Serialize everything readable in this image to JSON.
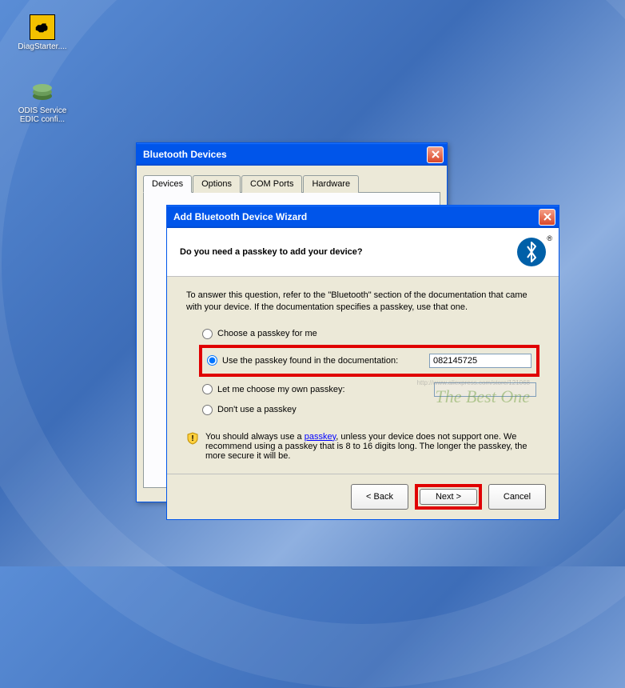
{
  "desktop": {
    "icons": [
      {
        "label": "DiagStarter...."
      },
      {
        "label": "ODIS Service EDIC confi..."
      }
    ]
  },
  "bt_window": {
    "title": "Bluetooth Devices",
    "tabs": [
      "Devices",
      "Options",
      "COM Ports",
      "Hardware"
    ]
  },
  "wizard": {
    "title": "Add Bluetooth Device Wizard",
    "heading": "Do you need a passkey to add your device?",
    "instruction": "To answer this question, refer to the \"Bluetooth\" section of the documentation that came with your device. If the documentation specifies a passkey, use that one.",
    "radios": {
      "choose": "Choose a passkey for me",
      "documentation": "Use the passkey found in the documentation:",
      "own": "Let me choose my own passkey:",
      "none": "Don't use a passkey"
    },
    "passkey_value": "082145725",
    "note_prefix": "You should always use a ",
    "note_link": "passkey",
    "note_suffix": ", unless your device does not support one. We recommend using a passkey that is 8 to 16 digits long. The longer the passkey, the more secure it will be.",
    "buttons": {
      "back": "< Back",
      "next": "Next >",
      "cancel": "Cancel"
    }
  },
  "watermark": {
    "text": "The Best One",
    "url": "http://www.aliexpress.com/store/121068"
  }
}
